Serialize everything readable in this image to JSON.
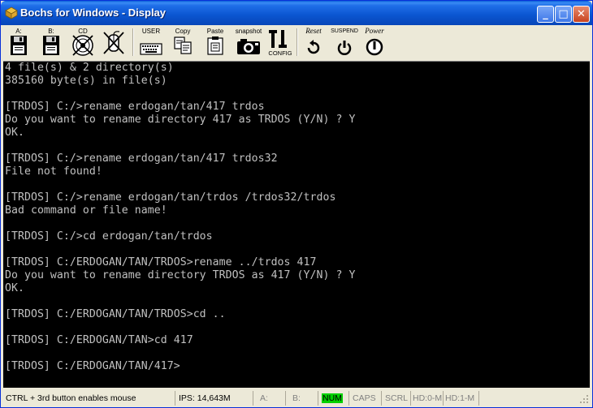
{
  "window": {
    "title": "Bochs for Windows - Display",
    "controls": {
      "minimize": "_",
      "maximize": "□",
      "close": "✕"
    }
  },
  "toolbar": {
    "items": [
      {
        "label": "A:",
        "icon": "floppy-a-icon"
      },
      {
        "label": "B:",
        "icon": "floppy-b-icon"
      },
      {
        "label": "CD",
        "icon": "cdrom-icon"
      },
      {
        "label": "",
        "icon": "mouse-disabled-icon"
      },
      {
        "label": "USER",
        "icon": "keyboard-icon"
      },
      {
        "label": "Copy",
        "icon": "copy-icon"
      },
      {
        "label": "Paste",
        "icon": "paste-icon"
      },
      {
        "label": "snapshot",
        "icon": "camera-icon"
      },
      {
        "label": "CONFIG",
        "icon": "config-icon"
      },
      {
        "label": "Reset",
        "icon": "reset-icon"
      },
      {
        "label": "SUSPEND",
        "icon": "suspend-icon"
      },
      {
        "label": "Power",
        "icon": "power-icon"
      }
    ]
  },
  "console": {
    "lines": [
      "4 file(s) & 2 directory(s)",
      "385160 byte(s) in file(s)",
      "",
      "[TRDOS] C:/>rename erdogan/tan/417 trdos",
      "Do you want to rename directory 417 as TRDOS (Y/N) ? Y",
      "OK.",
      "",
      "[TRDOS] C:/>rename erdogan/tan/417 trdos32",
      "File not found!",
      "",
      "[TRDOS] C:/>rename erdogan/tan/trdos /trdos32/trdos",
      "Bad command or file name!",
      "",
      "[TRDOS] C:/>cd erdogan/tan/trdos",
      "",
      "[TRDOS] C:/ERDOGAN/TAN/TRDOS>rename ../trdos 417",
      "Do you want to rename directory TRDOS as 417 (Y/N) ? Y",
      "OK.",
      "",
      "[TRDOS] C:/ERDOGAN/TAN/TRDOS>cd ..",
      "",
      "[TRDOS] C:/ERDOGAN/TAN>cd 417",
      "",
      "[TRDOS] C:/ERDOGAN/TAN/417>"
    ],
    "colors": {
      "background": "#000000",
      "text": "#c0c0c0"
    }
  },
  "statusbar": {
    "mouse_hint": "CTRL + 3rd button enables mouse",
    "ips": "IPS: 14,643M",
    "a": "A:",
    "b": "B:",
    "num": "NUM",
    "caps": "CAPS",
    "scrl": "SCRL",
    "hd0": "HD:0-M",
    "hd1": "HD:1-M",
    "num_active_color": "#00d000"
  }
}
